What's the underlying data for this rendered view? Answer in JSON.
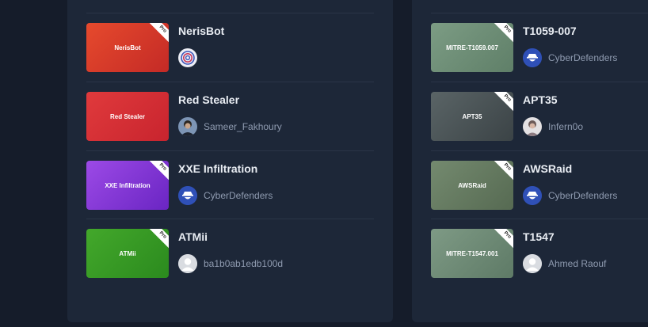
{
  "left_column": {
    "items": [
      {
        "title": "NerisBot",
        "thumb_label": "NerisBot",
        "pro_badge": "Pro",
        "author": "",
        "thumb_color": "#d9372a",
        "avatar_icon": "target-icon"
      },
      {
        "title": "Red Stealer",
        "thumb_label": "Red Stealer",
        "pro_badge": "",
        "author": "Sameer_Fakhoury",
        "thumb_color": "#d7323a",
        "avatar_icon": "user-photo-icon"
      },
      {
        "title": "XXE Infiltration",
        "thumb_label": "XXE Infiltration",
        "pro_badge": "Pro",
        "author": "CyberDefenders",
        "thumb_color": "#8a3fd9",
        "avatar_icon": "cyberdefenders-logo-icon"
      },
      {
        "title": "ATMii",
        "thumb_label": "ATMii",
        "pro_badge": "Pro",
        "author": "ba1b0ab1edb100d",
        "thumb_color": "#3a9a25",
        "avatar_icon": "default-user-icon"
      }
    ]
  },
  "right_column": {
    "items": [
      {
        "title": "T1059-007",
        "thumb_label": "MITRE-T1059.007",
        "pro_badge": "Pro",
        "author": "CyberDefenders",
        "thumb_color": "#6d8f77",
        "avatar_icon": "cyberdefenders-logo-icon"
      },
      {
        "title": "APT35",
        "thumb_label": "APT35",
        "pro_badge": "Pro",
        "author": "Infern0o",
        "thumb_color": "#4c5558",
        "avatar_icon": "user-photo-icon"
      },
      {
        "title": "AWSRaid",
        "thumb_label": "AWSRaid",
        "pro_badge": "Pro",
        "author": "CyberDefenders",
        "thumb_color": "#667a62",
        "avatar_icon": "cyberdefenders-logo-icon"
      },
      {
        "title": "T1547",
        "thumb_label": "MITRE-T1547.001",
        "pro_badge": "Pro",
        "author": "Ahmed Raouf",
        "thumb_color": "#6e8a76",
        "avatar_icon": "default-user-icon"
      }
    ]
  },
  "colors": {
    "background": "#151c2a",
    "panel": "#1d2738",
    "title_text": "#e9edf3",
    "author_text": "#8f9bb0"
  }
}
